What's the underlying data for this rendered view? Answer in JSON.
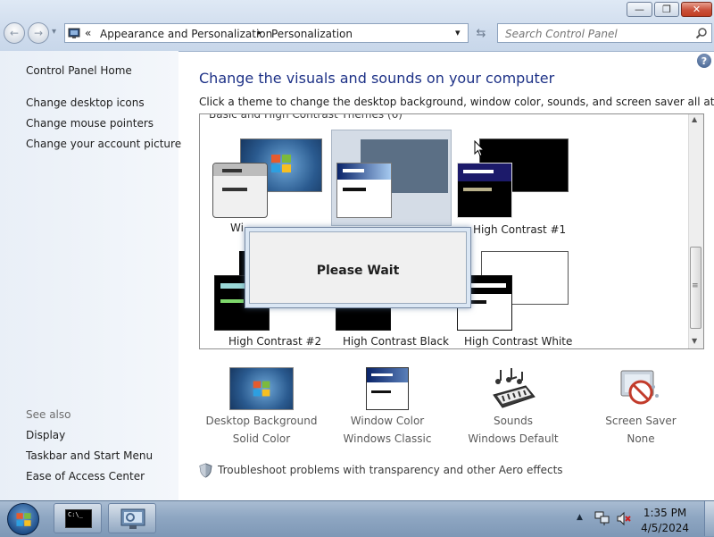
{
  "window": {
    "minimize_glyph": "—",
    "maximize_glyph": "❐",
    "close_glyph": "✕"
  },
  "nav": {
    "back_glyph": "←",
    "forward_glyph": "→",
    "dropdown_glyph": "▾"
  },
  "address": {
    "prefix": "«",
    "crumb1": "Appearance and Personalization",
    "sep": "▸",
    "crumb2": "Personalization",
    "dropdown_glyph": "▾",
    "refresh_glyph": "⇆"
  },
  "search": {
    "placeholder": "Search Control Panel"
  },
  "help_glyph": "?",
  "left": {
    "home": "Control Panel Home",
    "links": [
      "Change desktop icons",
      "Change mouse pointers",
      "Change your account picture"
    ],
    "see_also_label": "See also",
    "see_also": [
      "Display",
      "Taskbar and Start Menu",
      "Ease of Access Center"
    ]
  },
  "main": {
    "heading": "Change the visuals and sounds on your computer",
    "subtext": "Click a theme to change the desktop background, window color, sounds, and screen saver all at once.",
    "section_header": "Basic and High Contrast Themes (6)",
    "themes": [
      "Wi",
      "High Contrast #1",
      "High Contrast #2",
      "High Contrast Black",
      "High Contrast White"
    ],
    "scroll_up": "▲",
    "scroll_down": "▼",
    "scroll_grip": "≡"
  },
  "dialog": {
    "text": "Please Wait"
  },
  "bottom": {
    "items": [
      {
        "title": "Desktop Background",
        "value": "Solid Color"
      },
      {
        "title": "Window Color",
        "value": "Windows Classic"
      },
      {
        "title": "Sounds",
        "value": "Windows Default"
      },
      {
        "title": "Screen Saver",
        "value": "None"
      }
    ],
    "troubleshoot": "Troubleshoot problems with transparency and other Aero effects"
  },
  "taskbar": {
    "tray_expand": "▲",
    "time": "1:35 PM",
    "date": "4/5/2024",
    "cmd_text": "C:\\_"
  },
  "colors": {
    "heading": "#1e3287",
    "link": "#1e1e1e",
    "muted": "#6d6d6d"
  }
}
